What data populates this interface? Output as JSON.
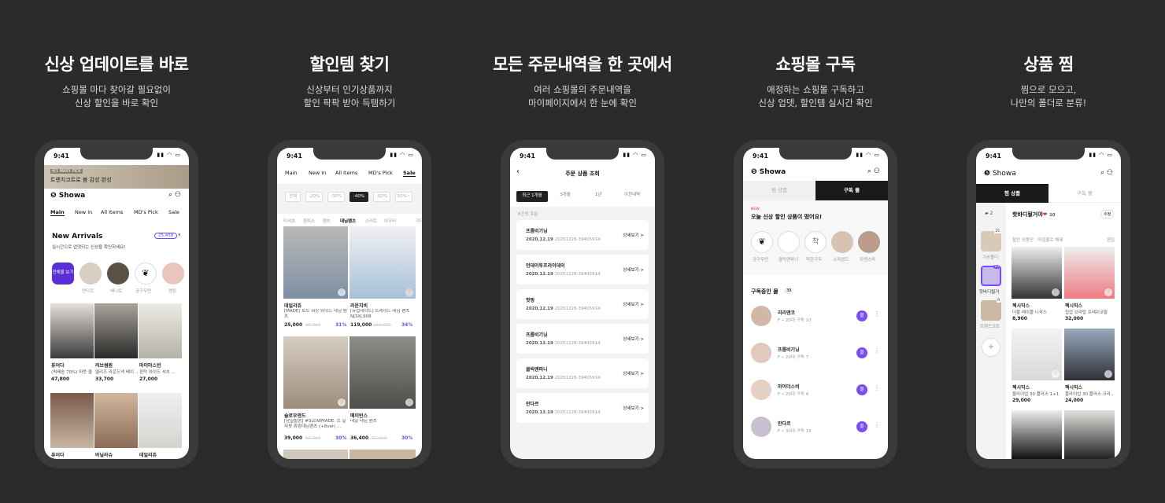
{
  "panels": [
    {
      "title": "신상 업데이트를 바로",
      "sub1": "쇼핑몰 마다 찾아갈 필요없이",
      "sub2": "신상 할인을 바로 확인"
    },
    {
      "title": "할인템 찾기",
      "sub1": "신상부터 인기상품까지",
      "sub2": "할인 팍팍 받아 득템하기"
    },
    {
      "title": "모든 주문내역을 한 곳에서",
      "sub1": "여러 쇼핑몰의 주문내역을",
      "sub2": "마이페이지에서 한 눈에 확인"
    },
    {
      "title": "쇼핑몰 구독",
      "sub1": "애정하는 쇼핑몰 구독하고",
      "sub2": "신상 업뎃, 할인템 실시간 확인"
    },
    {
      "title": "상품 찜",
      "sub1": "찜으로 모으고,",
      "sub2": "나만의 폴더로 분류!"
    }
  ],
  "status": {
    "time": "9:41",
    "icons": "▮▮ ◠ ▭"
  },
  "brand": "Showa",
  "p1": {
    "banner": "트렌치코트로 봄 감성 완성",
    "banner_tag": "4/1 MAXY PICK",
    "tabs": [
      "Main",
      "New In",
      "All Items",
      "MD's Pick",
      "Sale"
    ],
    "section": "New Arrivals",
    "badge": "25,458",
    "desc": "실시간으로 업뎃되는 신상을 확인하세요!",
    "allbtn": "전체몰 보기",
    "shops": [
      "언더르",
      "베니토",
      "공구우먼",
      "랭킹"
    ],
    "items": [
      {
        "shop": "퓨어다",
        "name": "(퀵배송 70%) 따뜻 울 ...",
        "price": "47,800"
      },
      {
        "shop": "러브썸원",
        "name": "엘리즈 라운드넥 베이 ...",
        "price": "33,700"
      },
      {
        "shop": "마이마스빈",
        "name": "핀턱 와이드 셔츠 ...",
        "price": "27,000"
      }
    ],
    "row2": [
      "퓨어다",
      "바닐라슈",
      "데일리쥬"
    ]
  },
  "p2": {
    "tabs": [
      "Main",
      "New In",
      "All Items",
      "MD's Pick",
      "Sale"
    ],
    "chips": [
      "전체",
      "-20%",
      "-30%",
      "-40%",
      "-50%",
      "50%~"
    ],
    "cats": [
      "티셔츠",
      "원피스",
      "팬츠",
      "데님팬츠",
      "스커트",
      "아우터",
      "가디"
    ],
    "items": [
      {
        "shop": "데일리쥬",
        "name": "[MADE] 토트 워싱 와이드 데님 팬츠",
        "price": "25,000",
        "old": "36,000",
        "pct": "31%"
      },
      {
        "shop": "라운지비",
        "name": "[뉴업데이트] 트레이드 데님 팬츠 NJ3XL908",
        "price": "119,000",
        "old": "180,000",
        "pct": "34%"
      },
      {
        "shop": "슬로우앤드",
        "name": "[당일발송] #SLOWMADE. 르 일자핏 휴링데님팬츠 (+8ver) ...",
        "price": "39,000",
        "old": "56,000",
        "pct": "30%"
      },
      {
        "shop": "메이빈스",
        "name": "데일 데님 팬츠",
        "price": "36,400",
        "old": "52,000",
        "pct": "30%"
      }
    ]
  },
  "p3": {
    "title": "주문 상품 조회",
    "ranges": [
      "최근 1개월",
      "3개월",
      "1년",
      "이전내역"
    ],
    "count": "6건의 주문",
    "orders": [
      {
        "shop": "프롬비기닝",
        "date": "2020.12.19",
        "no": "20201228-39405914"
      },
      {
        "shop": "언데이투프라이데이",
        "date": "2020.12.19",
        "no": "20201228-39405914"
      },
      {
        "shop": "핫핑",
        "date": "2020.12.19",
        "no": "20201228-39405914"
      },
      {
        "shop": "프롬비기닝",
        "date": "2020.12.19",
        "no": "20201228-39405914"
      },
      {
        "shop": "클릭앤퍼니",
        "date": "2020.12.19",
        "no": "20201228-39405914"
      },
      {
        "shop": "안다르",
        "date": "2020.12.19",
        "no": "20201228-39405914"
      }
    ],
    "detail": "상세보기 >"
  },
  "p4": {
    "tabs": [
      "찜 상품",
      "구독 몰"
    ],
    "newtag": "NEW",
    "alert": "오늘 신상 할인 상품이 떴어요!",
    "shops": [
      "공구우먼",
      "클릭앤퍼니",
      "착한구두",
      "소피렌드",
      "모멘스마"
    ],
    "subtitle": "구독중인 몰",
    "subcount": "39",
    "subs": [
      {
        "name": "리리앤코",
        "meta": "F • 20대  구독 10"
      },
      {
        "name": "프롬비기닝",
        "meta": "F • 20대  구독 7"
      },
      {
        "name": "마이더스비",
        "meta": "F • 20대  구독 4"
      },
      {
        "name": "안다르",
        "meta": "F • 30대  구독 19"
      }
    ],
    "sub_btn": "몰"
  },
  "p5": {
    "tabs": [
      "찜 상품",
      "구독 몰"
    ],
    "foldercount": "2",
    "folder_title": "핫바디될거야",
    "folder_icon": "❤",
    "folder_count": "10",
    "edit": "수정",
    "sub": "할인 상품만 · 마일몰로 해제",
    "edit2": "편집",
    "folders": [
      {
        "name": "기본폴더",
        "n": "25"
      },
      {
        "name": "핫바디될거",
        "n": "10"
      },
      {
        "name": "트렌드코트",
        "n": "9"
      }
    ],
    "items": [
      {
        "shop": "젝시믹스",
        "name": "더블 레이블 니삭스",
        "price": "8,900"
      },
      {
        "shop": "젝시믹스",
        "name": "집업 브라탑 프레쉬코랄",
        "price": "32,000"
      },
      {
        "shop": "젝시믹스",
        "name": "블라이업 30 플러스 1+1",
        "price": "29,000"
      },
      {
        "shop": "젝시믹스",
        "name": "블라이업 30 플러스 크라...",
        "price": "24,000"
      }
    ]
  }
}
